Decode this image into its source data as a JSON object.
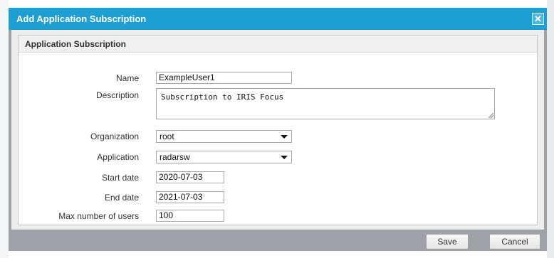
{
  "dialog": {
    "title": "Add Application Subscription",
    "close_glyph": "✕"
  },
  "panel": {
    "title": "Application Subscription"
  },
  "form": {
    "name": {
      "label": "Name",
      "value": "ExampleUser1"
    },
    "description": {
      "label": "Description",
      "value": "Subscription to IRIS Focus"
    },
    "organization": {
      "label": "Organization",
      "value": "root"
    },
    "application": {
      "label": "Application",
      "value": "radarsw"
    },
    "start_date": {
      "label": "Start date",
      "value": "2020-07-03"
    },
    "end_date": {
      "label": "End date",
      "value": "2021-07-03"
    },
    "max_users": {
      "label": "Max number of users",
      "value": "100"
    }
  },
  "buttons": {
    "save": "Save",
    "cancel": "Cancel"
  },
  "colors": {
    "titlebar": "#1e9fd4",
    "frame": "#9ea2a6",
    "content_bg": "#ededed"
  }
}
